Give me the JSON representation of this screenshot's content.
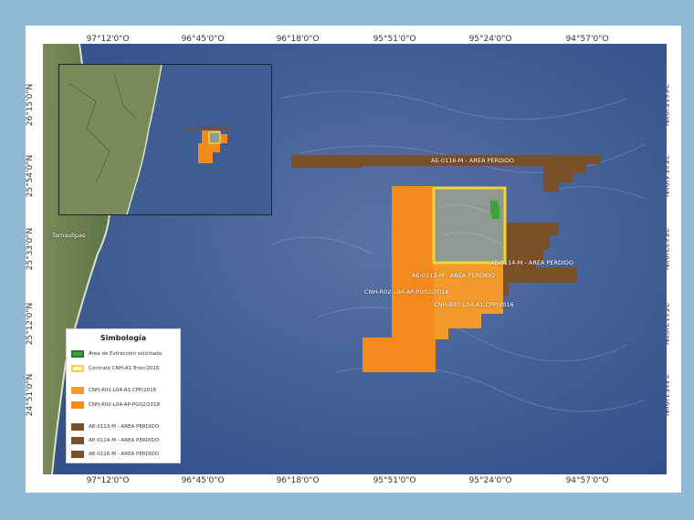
{
  "map": {
    "top_ticks": [
      "97°12'0\"O",
      "96°45'0\"O",
      "96°18'0\"O",
      "95°51'0\"O",
      "95°24'0\"O",
      "94°57'0\"O"
    ],
    "bottom_ticks": [
      "97°12'0\"O",
      "96°45'0\"O",
      "96°18'0\"O",
      "95°51'0\"O",
      "95°24'0\"O",
      "94°57'0\"O"
    ],
    "left_ticks": [
      "26°15'0\"N",
      "25°54'0\"N",
      "25°33'0\"N",
      "25°12'0\"N",
      "24°51'0\"N"
    ],
    "right_ticks": [
      "26°15'0\"N",
      "25°54'0\"N",
      "25°33'0\"N",
      "25°12'0\"N",
      "24°51'0\"N"
    ],
    "city_label": "Tamaulipas",
    "area_labels": {
      "ae0116": "AE-0116-M - AREA PERDIDO",
      "ae0114": "AE-0114-M - AREA PERDIDO",
      "ae0113": "AE-0113-M - AREA PERDIDO",
      "cnh_r02": "CNH-R02-L04-AP-PG02/2018",
      "cnh_r01": "CNH-R01-L04-A1.CPP/2016"
    }
  },
  "legend": {
    "title": "Simbología",
    "items": [
      {
        "label": "Área de Extracción solicitada",
        "color": "#3aa63a",
        "border": "#2a7a2a"
      },
      {
        "label": "Contrato CNH-A1-Trion/2016",
        "color": "#fff3b0",
        "border": "#f2d43a"
      },
      {
        "label": "CNH-R01-L04-A1.CPP/2016",
        "color": "#f39a2c",
        "border": "#f39a2c"
      },
      {
        "label": "CNH-R02-L04-AP-PG02/2018",
        "color": "#f28a1c",
        "border": "#f28a1c"
      },
      {
        "label": "AE-0113-M - AREA PERDIDO",
        "color": "#7a5028",
        "border": "#7a5028"
      },
      {
        "label": "AE-0114-M - AREA PERDIDO",
        "color": "#7a5028",
        "border": "#7a5028"
      },
      {
        "label": "AE-0116-M - AREA PERDIDO",
        "color": "#7a5028",
        "border": "#7a5028"
      }
    ]
  },
  "colors": {
    "sea": "#3d5a8f",
    "land": "#5f7a4a",
    "orange": "#f28a1c",
    "brown": "#7a5028",
    "yellow": "#f2d43a",
    "green": "#3aa63a"
  }
}
